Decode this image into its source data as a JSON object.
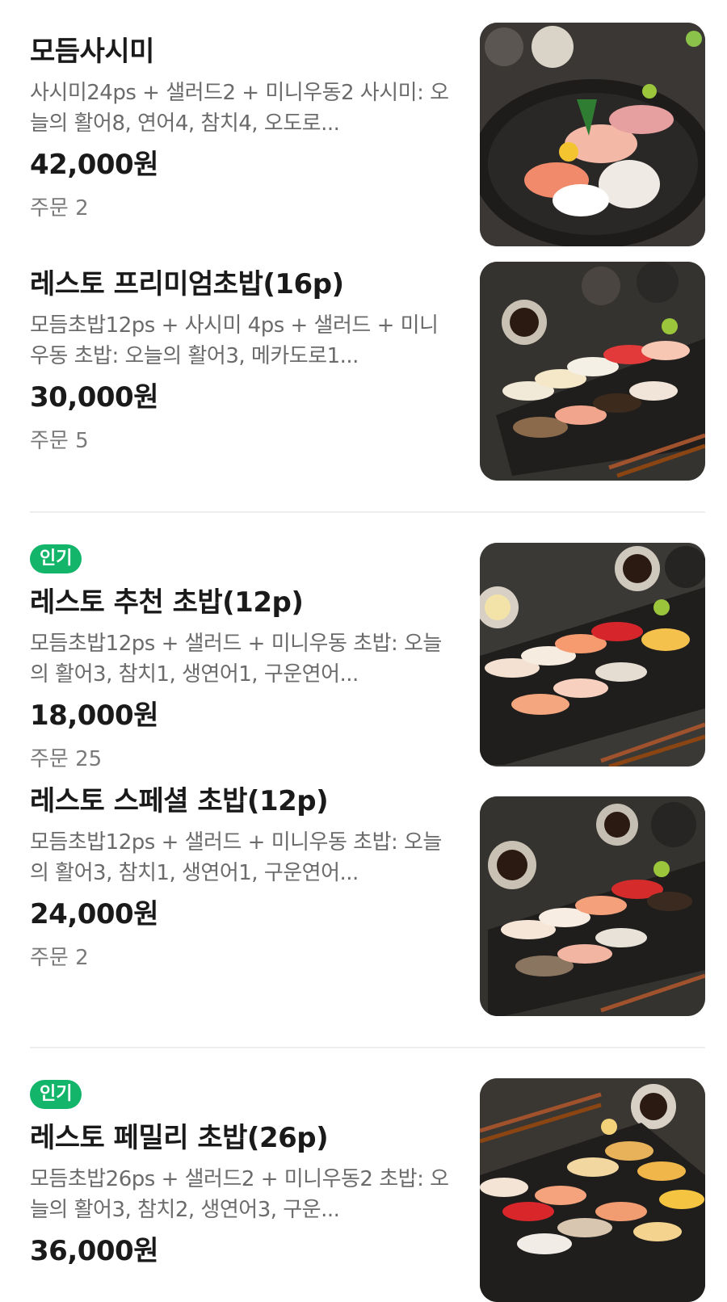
{
  "menu": {
    "items": [
      {
        "title": "모듬사시미",
        "badge": "",
        "desc": "사시미24ps + 샐러드2 + 미니우동2 사시미: 오늘의 활어8, 연어4, 참치4, 오도로...",
        "price": "42,000원",
        "orders": "주문 2",
        "image": "sashimi-platter-photo"
      },
      {
        "title": "레스토 프리미엄초밥(16p)",
        "badge": "",
        "desc": "모듬초밥12ps + 사시미 4ps + 샐러드 + 미니우동 초밥: 오늘의 활어3, 메카도로1...",
        "price": "30,000원",
        "orders": "주문 5",
        "image": "premium-sushi-photo"
      },
      {
        "title": "레스토 추천 초밥(12p)",
        "badge": "인기",
        "desc": "모듬초밥12ps + 샐러드 + 미니우동 초밥: 오늘의 활어3, 참치1, 생연어1, 구운연어...",
        "price": "18,000원",
        "orders": "주문 25",
        "image": "recommended-sushi-photo"
      },
      {
        "title": "레스토 스페셜 초밥(12p)",
        "badge": "",
        "desc": "모듬초밥12ps + 샐러드 + 미니우동 초밥: 오늘의 활어3, 참치1, 생연어1, 구운연어...",
        "price": "24,000원",
        "orders": "주문 2",
        "image": "special-sushi-photo"
      },
      {
        "title": "레스토 페밀리 초밥(26p)",
        "badge": "인기",
        "desc": "모듬초밥26ps + 샐러드2 + 미니우동2 초밥: 오늘의 활어3, 참치2, 생연어3, 구운...",
        "price": "36,000원",
        "orders": "",
        "image": "family-sushi-photo"
      }
    ]
  },
  "colors": {
    "badge_green": "#12b56a",
    "text_primary": "#1a1a1a",
    "text_secondary": "#6b6b6b",
    "divider": "#eeeeee"
  }
}
